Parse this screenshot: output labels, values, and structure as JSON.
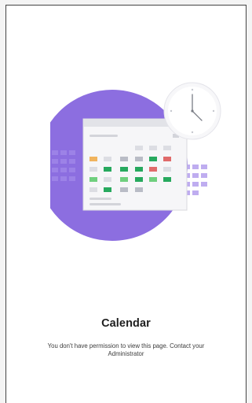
{
  "page": {
    "title": "Calendar",
    "message": "You don't have permission to view this page. Contact your Administrator"
  },
  "illustration": {
    "icon": "calendar-clock-illustration",
    "circle_color": "#8c6ee0",
    "day_colors": {
      "green": "#27a95e",
      "light_green": "#6fcf7e",
      "red": "#e06a6a",
      "orange": "#f0b45e",
      "gray": "#b9bcc6",
      "light_gray": "#dcdde3"
    }
  }
}
